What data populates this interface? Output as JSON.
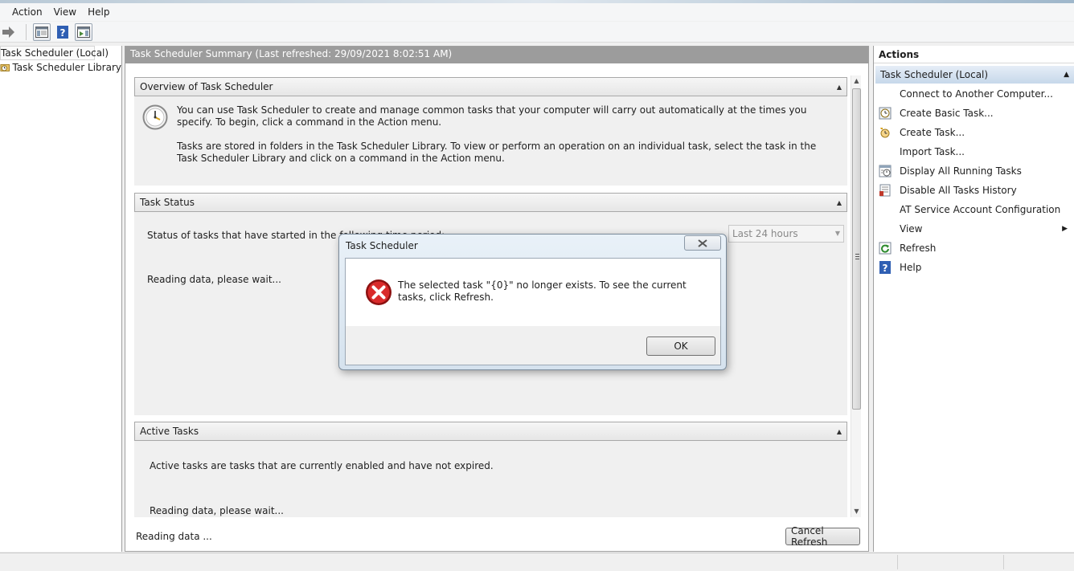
{
  "menu": [
    "Action",
    "View",
    "Help"
  ],
  "tree": {
    "root": "Task Scheduler (Local)",
    "library": "Task Scheduler Library"
  },
  "center": {
    "header": "Task Scheduler Summary (Last refreshed: 29/09/2021 8:02:51 AM)",
    "overview": {
      "title": "Overview of Task Scheduler",
      "para1": "You can use Task Scheduler to create and manage common tasks that your computer will carry out automatically at the times you specify. To begin, click a command in the Action menu.",
      "para2": "Tasks are stored in folders in the Task Scheduler Library. To view or perform an operation on an individual task, select the task in the Task Scheduler Library and click on a command in the Action menu."
    },
    "task_status": {
      "title": "Task Status",
      "period_label": "Status of tasks that have started in the following time period:",
      "period_select": "Last 24 hours",
      "reading": "Reading data, please wait..."
    },
    "active_tasks": {
      "title": "Active Tasks",
      "description": "Active tasks are tasks that are currently enabled and have not expired.",
      "reading": "Reading data, please wait..."
    },
    "status_text": "Reading data ...",
    "cancel_refresh": "Cancel Refresh"
  },
  "actions": {
    "title": "Actions",
    "group": "Task Scheduler (Local)",
    "items": [
      {
        "label": "Connect to Another Computer...",
        "icon": "none"
      },
      {
        "label": "Create Basic Task...",
        "icon": "create-basic-task-icon"
      },
      {
        "label": "Create Task...",
        "icon": "create-task-icon"
      },
      {
        "label": "Import Task...",
        "icon": "none"
      },
      {
        "label": "Display All Running Tasks",
        "icon": "running-tasks-icon"
      },
      {
        "label": "Disable All Tasks History",
        "icon": "history-icon"
      },
      {
        "label": "AT Service Account Configuration",
        "icon": "none"
      },
      {
        "label": "View",
        "icon": "none"
      },
      {
        "label": "Refresh",
        "icon": "refresh-icon"
      },
      {
        "label": "Help",
        "icon": "help-icon"
      }
    ]
  },
  "dialog": {
    "title": "Task Scheduler",
    "message": "The selected task \"{0}\" no longer exists. To see the current tasks, click Refresh.",
    "ok": "OK"
  }
}
